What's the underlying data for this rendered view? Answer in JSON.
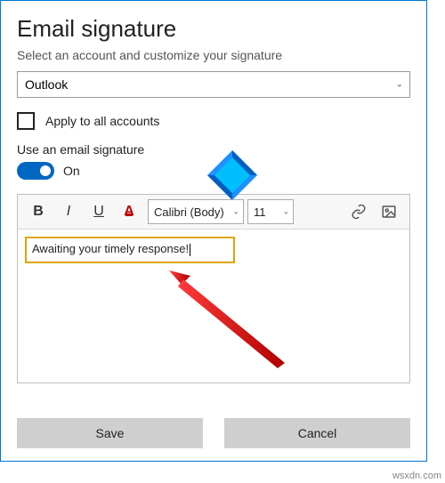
{
  "title": "Email signature",
  "subtitle": "Select an account and customize your signature",
  "account_select_value": "Outlook",
  "apply_all_label": "Apply to all accounts",
  "use_signature_label": "Use an email signature",
  "toggle_state": "On",
  "toolbar": {
    "bold": "B",
    "italic": "I",
    "underline": "U",
    "font_color": "A",
    "font_name": "Calibri (Body)",
    "font_size": "11"
  },
  "signature_text": "Awaiting your timely response!",
  "buttons": {
    "save": "Save",
    "cancel": "Cancel"
  },
  "watermark": "wsxdn.com"
}
